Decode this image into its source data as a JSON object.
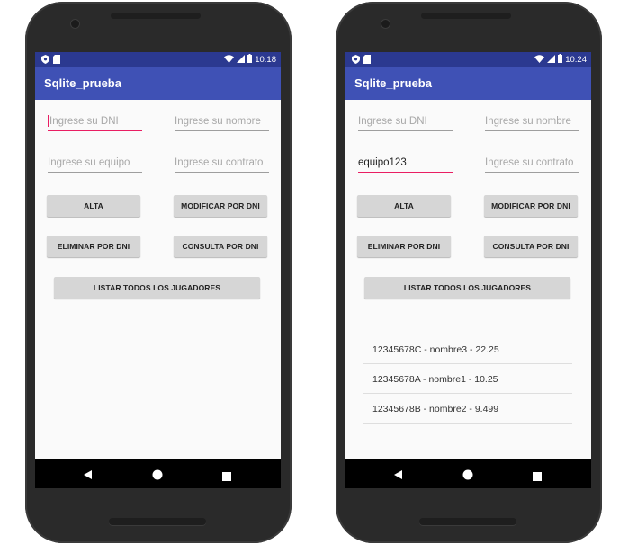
{
  "left_screen": {
    "status": {
      "time": "10:18"
    },
    "app_title": "Sqlite_prueba",
    "fields": {
      "dni": {
        "placeholder": "Ingrese su DNI",
        "value": ""
      },
      "nombre": {
        "placeholder": "Ingrese su nombre",
        "value": ""
      },
      "equipo": {
        "placeholder": "Ingrese su equipo",
        "value": ""
      },
      "contrato": {
        "placeholder": "Ingrese su contrato",
        "value": ""
      }
    },
    "buttons": {
      "alta": "ALTA",
      "modificar": "MODIFICAR POR DNI",
      "eliminar": "ELIMINAR POR DNI",
      "consulta": "CONSULTA POR DNI",
      "listar": "LISTAR TODOS LOS JUGADORES"
    }
  },
  "right_screen": {
    "status": {
      "time": "10:24"
    },
    "app_title": "Sqlite_prueba",
    "fields": {
      "dni": {
        "placeholder": "Ingrese su DNI",
        "value": ""
      },
      "nombre": {
        "placeholder": "Ingrese su nombre",
        "value": ""
      },
      "equipo": {
        "placeholder": "Ingrese su equipo",
        "value": "equipo123"
      },
      "contrato": {
        "placeholder": "Ingrese su contrato",
        "value": ""
      }
    },
    "buttons": {
      "alta": "ALTA",
      "modificar": "MODIFICAR POR DNI",
      "eliminar": "ELIMINAR POR DNI",
      "consulta": "CONSULTA POR DNI",
      "listar": "LISTAR TODOS LOS JUGADORES"
    },
    "list": [
      "12345678C - nombre3 - 22.25",
      "12345678A - nombre1 - 10.25",
      "12345678B - nombre2 - 9.499"
    ]
  },
  "colors": {
    "primary": "#3f51b5",
    "primary_dark": "#2b3990",
    "accent": "#e91e63"
  },
  "icons": [
    "shield-icon",
    "sd-card-icon",
    "wifi-icon",
    "signal-icon",
    "battery-icon",
    "back-icon",
    "home-icon",
    "recents-icon"
  ]
}
